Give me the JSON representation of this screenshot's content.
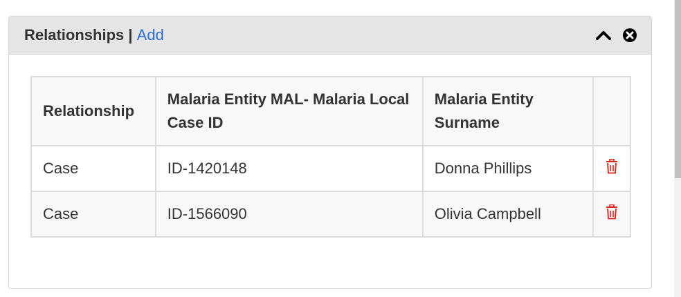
{
  "panel": {
    "title": "Relationships",
    "separator": "|",
    "add_label": "Add",
    "icons": {
      "collapse": "chevron-up-icon",
      "close": "close-circle-icon"
    }
  },
  "table": {
    "headers": [
      "Relationship",
      "Malaria Entity MAL- Malaria Local Case ID",
      "Malaria Entity Surname",
      ""
    ],
    "rows": [
      {
        "relationship": "Case",
        "local_case_id": "ID-1420148",
        "surname": "Donna Phillips",
        "action_icon": "trash-icon"
      },
      {
        "relationship": "Case",
        "local_case_id": "ID-1566090",
        "surname": "Olivia Campbell",
        "action_icon": "trash-icon"
      }
    ]
  },
  "colors": {
    "link": "#2a6ccf",
    "delete": "#d9231d",
    "header_bg": "#e5e5e5",
    "text": "#333333"
  }
}
